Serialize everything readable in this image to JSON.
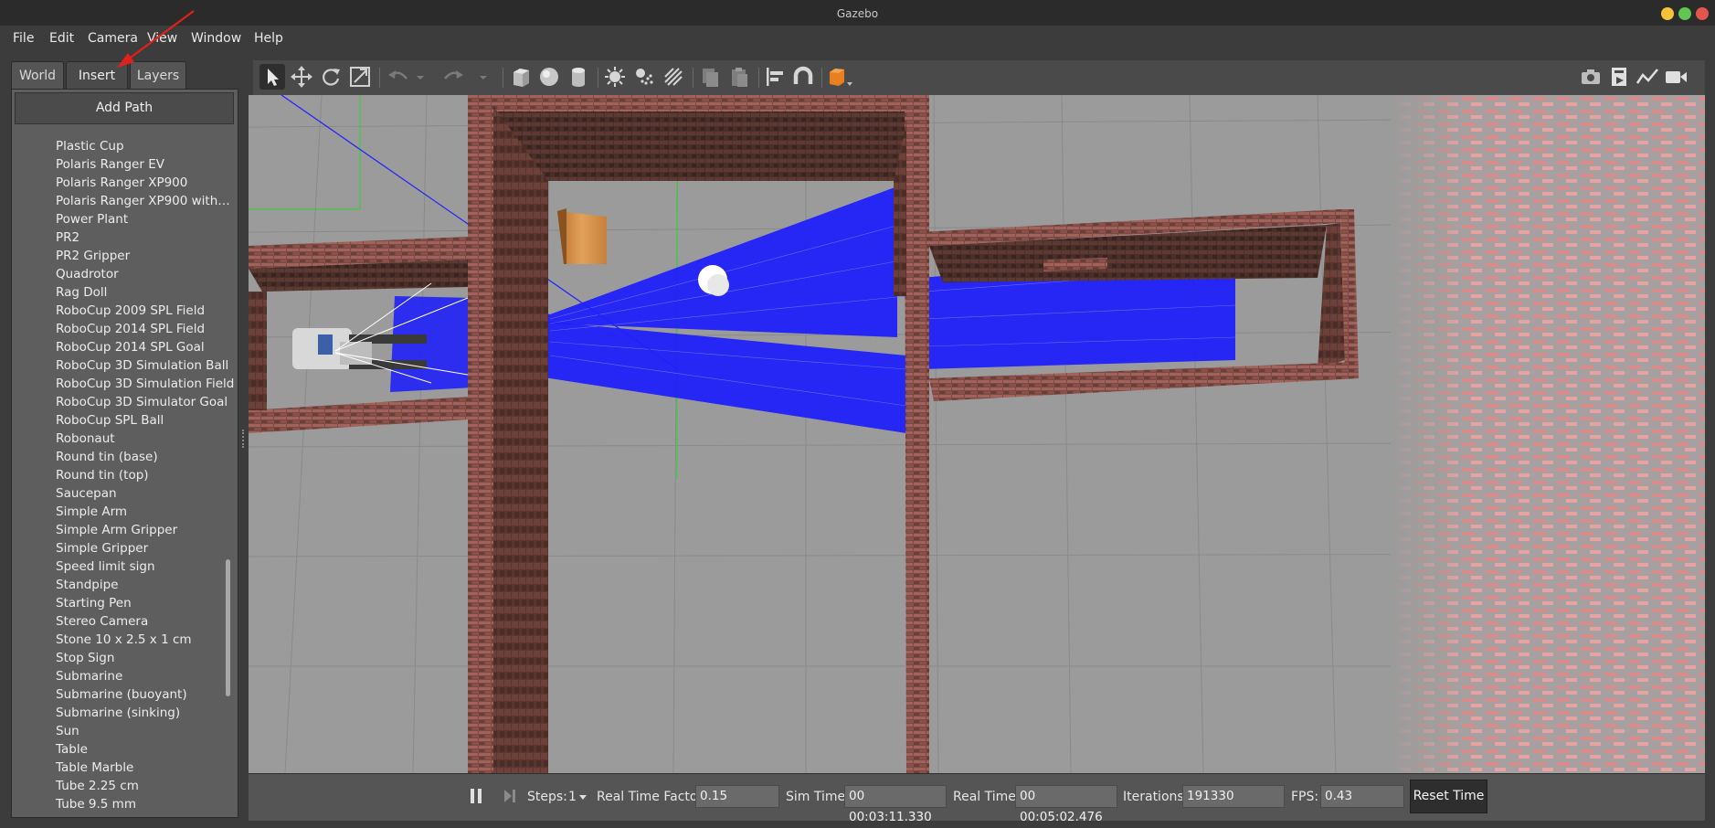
{
  "window": {
    "title": "Gazebo"
  },
  "colors": {
    "close": "#e2574c",
    "minimize": "#f5c33b",
    "maximize": "#62c554",
    "accent_arrow": "#e0211b",
    "laser": "#1a1aff"
  },
  "menu": {
    "file": "File",
    "edit": "Edit",
    "camera": "Camera",
    "view": "View",
    "window": "Window",
    "help": "Help"
  },
  "tabs": {
    "world": "World",
    "insert": "Insert",
    "layers": "Layers",
    "active": "Insert"
  },
  "insert_panel": {
    "add_path_label": "Add Path",
    "models": [
      "Plastic Cup",
      "Polaris Ranger EV",
      "Polaris Ranger XP900",
      "Polaris Ranger XP900 witho…",
      "Power Plant",
      "PR2",
      "PR2 Gripper",
      "Quadrotor",
      "Rag Doll",
      "RoboCup 2009 SPL Field",
      "RoboCup 2014 SPL Field",
      "RoboCup 2014 SPL Goal",
      "RoboCup 3D Simulation Ball",
      "RoboCup 3D Simulation Field",
      "RoboCup 3D Simulator Goal",
      "RoboCup SPL Ball",
      "Robonaut",
      "Round tin (base)",
      "Round tin (top)",
      "Saucepan",
      "Simple Arm",
      "Simple Arm Gripper",
      "Simple Gripper",
      "Speed limit sign",
      "Standpipe",
      "Starting Pen",
      "Stereo Camera",
      "Stone 10 x 2.5 x 1 cm",
      "Stop Sign",
      "Submarine",
      "Submarine (buoyant)",
      "Submarine (sinking)",
      "Sun",
      "Table",
      "Table Marble",
      "Tube 2.25 cm",
      "Tube 9.5 mm"
    ]
  },
  "toolbar": {
    "left_icons": [
      "select-arrow-icon",
      "translate-icon",
      "rotate-icon",
      "scale-icon",
      "undo-icon",
      "undo-dropdown-icon",
      "redo-icon",
      "redo-dropdown-icon",
      "box-icon",
      "sphere-icon",
      "cylinder-icon",
      "point-light-icon",
      "spot-light-icon",
      "directional-light-icon",
      "copy-icon",
      "paste-icon",
      "align-icon",
      "snap-magnet-icon",
      "view-angle-icon"
    ],
    "right_icons": [
      "screenshot-camera-icon",
      "log-icon",
      "plot-icon",
      "video-record-icon"
    ]
  },
  "statusbar": {
    "steps_label": "Steps:",
    "steps_value": "1",
    "rtf_label": "Real Time Factor:",
    "rtf_value": "0.15",
    "sim_time_label": "Sim Time:",
    "sim_time_value": "00 00:03:11.330",
    "real_time_label": "Real Time:",
    "real_time_value": "00 00:05:02.476",
    "iterations_label": "Iterations:",
    "iterations_value": "191330",
    "fps_label": "FPS:",
    "fps_value": "0.43",
    "reset_label": "Reset Time"
  }
}
